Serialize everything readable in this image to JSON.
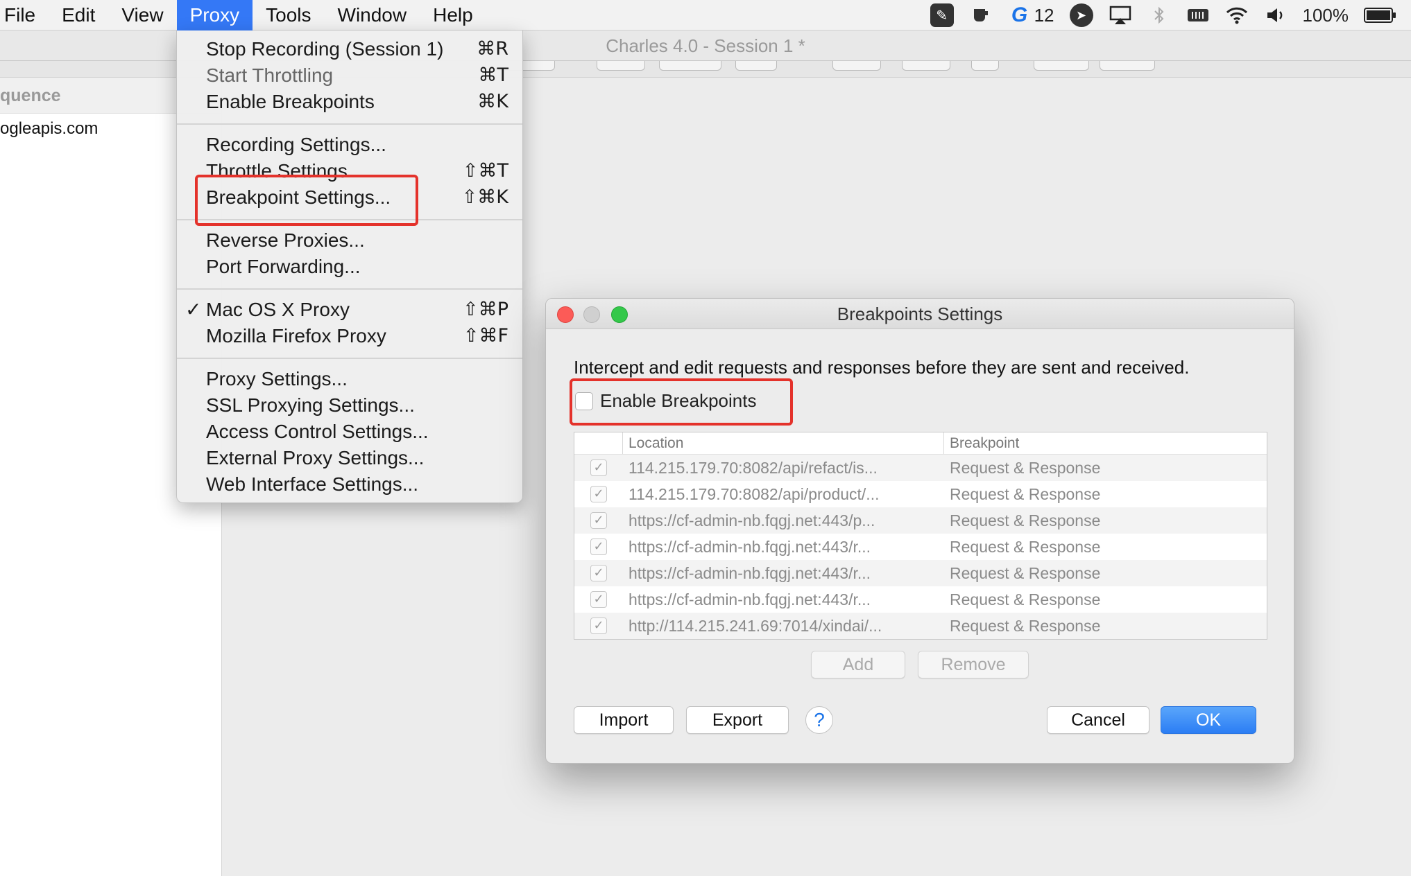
{
  "menubar": {
    "items": [
      "File",
      "Edit",
      "View",
      "Proxy",
      "Tools",
      "Window",
      "Help"
    ],
    "active": "Proxy",
    "status": {
      "notif_count": "12",
      "battery": "100%"
    }
  },
  "window": {
    "title": "Charles 4.0 - Session 1 *"
  },
  "leftpane": {
    "header": "quence",
    "rows": [
      "ogleapis.com"
    ]
  },
  "proxy_menu": {
    "groups": [
      [
        {
          "label": "Stop Recording (Session 1)",
          "shortcut": "⌘R"
        },
        {
          "label": "Start Throttling",
          "shortcut": "⌘T"
        },
        {
          "label": "Enable Breakpoints",
          "shortcut": "⌘K"
        }
      ],
      [
        {
          "label": "Recording Settings...",
          "shortcut": ""
        },
        {
          "label": "Throttle Settings...",
          "shortcut": "⇧⌘T"
        },
        {
          "label": "Breakpoint Settings...",
          "shortcut": "⇧⌘K"
        }
      ],
      [
        {
          "label": "Reverse Proxies...",
          "shortcut": ""
        },
        {
          "label": "Port Forwarding...",
          "shortcut": ""
        }
      ],
      [
        {
          "label": "Mac OS X Proxy",
          "shortcut": "⇧⌘P",
          "checked": true
        },
        {
          "label": "Mozilla Firefox Proxy",
          "shortcut": "⇧⌘F"
        }
      ],
      [
        {
          "label": "Proxy Settings...",
          "shortcut": ""
        },
        {
          "label": "SSL Proxying Settings...",
          "shortcut": ""
        },
        {
          "label": "Access Control Settings...",
          "shortcut": ""
        },
        {
          "label": "External Proxy Settings...",
          "shortcut": ""
        },
        {
          "label": "Web Interface Settings...",
          "shortcut": ""
        }
      ]
    ]
  },
  "dialog": {
    "title": "Breakpoints Settings",
    "description": "Intercept and edit requests and responses before they are sent and received.",
    "enable_label": "Enable Breakpoints",
    "enable_checked": false,
    "columns": [
      "Location",
      "Breakpoint"
    ],
    "rows": [
      {
        "location": "114.215.179.70:8082/api/refact/is...",
        "breakpoint": "Request & Response"
      },
      {
        "location": "114.215.179.70:8082/api/product/...",
        "breakpoint": "Request & Response"
      },
      {
        "location": "https://cf-admin-nb.fqgj.net:443/p...",
        "breakpoint": "Request & Response"
      },
      {
        "location": "https://cf-admin-nb.fqgj.net:443/r...",
        "breakpoint": "Request & Response"
      },
      {
        "location": "https://cf-admin-nb.fqgj.net:443/r...",
        "breakpoint": "Request & Response"
      },
      {
        "location": "https://cf-admin-nb.fqgj.net:443/r...",
        "breakpoint": "Request & Response"
      },
      {
        "location": "http://114.215.241.69:7014/xindai/...",
        "breakpoint": "Request & Response"
      }
    ],
    "buttons": {
      "add": "Add",
      "remove": "Remove",
      "import": "Import",
      "export": "Export",
      "help": "?",
      "cancel": "Cancel",
      "ok": "OK"
    }
  },
  "colors": {
    "menu_active": "#3478f6",
    "highlight": "#e4322b",
    "ok_button": "#2b7df4"
  }
}
